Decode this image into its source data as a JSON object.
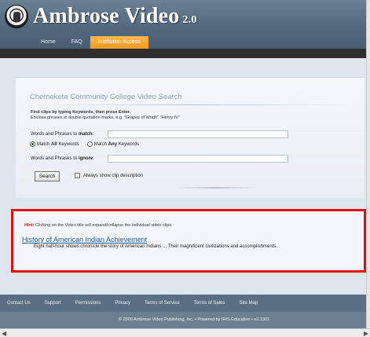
{
  "header": {
    "brand_name": "Ambrose Video",
    "brand_version": "2.0"
  },
  "nav": {
    "tabs": [
      {
        "label": "Home"
      },
      {
        "label": "FAQ"
      },
      {
        "label": "Institution Access",
        "active": true
      }
    ]
  },
  "search": {
    "title": "Chemeketa Community College Video Search",
    "instruction_bold": "Find clips by typing Keywords, then press Enter.",
    "instruction_sub": "Enclose phrases in double quotation marks, e.g. \"Grapes of Wrath\"   \"Henry IV\"",
    "match_label_prefix": "Words and Phrases to ",
    "match_label_bold": "match",
    "match_label_suffix": ":",
    "match_value": "",
    "radio_all_prefix": "Match ",
    "radio_all_bold": "All",
    "radio_all_suffix": " Keywords",
    "radio_any_prefix": "Match ",
    "radio_any_bold": "Any",
    "radio_any_suffix": " Keywords",
    "ignore_label_prefix": "Words and Phrases to ",
    "ignore_label_bold": "ignore",
    "ignore_label_suffix": ":",
    "ignore_value": "",
    "search_button": "Search",
    "always_show_desc": "Always show clip description"
  },
  "results": {
    "hint_label": "Hint:",
    "hint_text": " Clicking on the Video title will expand/collapse the individual video clips.",
    "items": [
      {
        "title": "History of American Indian Achievement",
        "description": "Eight half-hour shows chronicle the story of American Indians ... Their magnificent civilizations and accomplishments."
      }
    ]
  },
  "footer": {
    "links": [
      "Contact Us",
      "Support",
      "Permissions",
      "Privacy",
      "Terms of Service",
      "Terms of Sales",
      "Site Map"
    ],
    "copyright": "© 2009 Ambrose Video Publishing, Inc. • Powered by IRIS Education • v2.1301"
  },
  "colors": {
    "accent_tab": "#f39a1d",
    "header_bg": "#52677c",
    "highlight_border": "#e3100f",
    "link": "#225c9b"
  },
  "icons": {
    "logo": "seal-logo-icon",
    "scroll_left": "arrow-left-icon",
    "scroll_right": "arrow-right-icon"
  }
}
